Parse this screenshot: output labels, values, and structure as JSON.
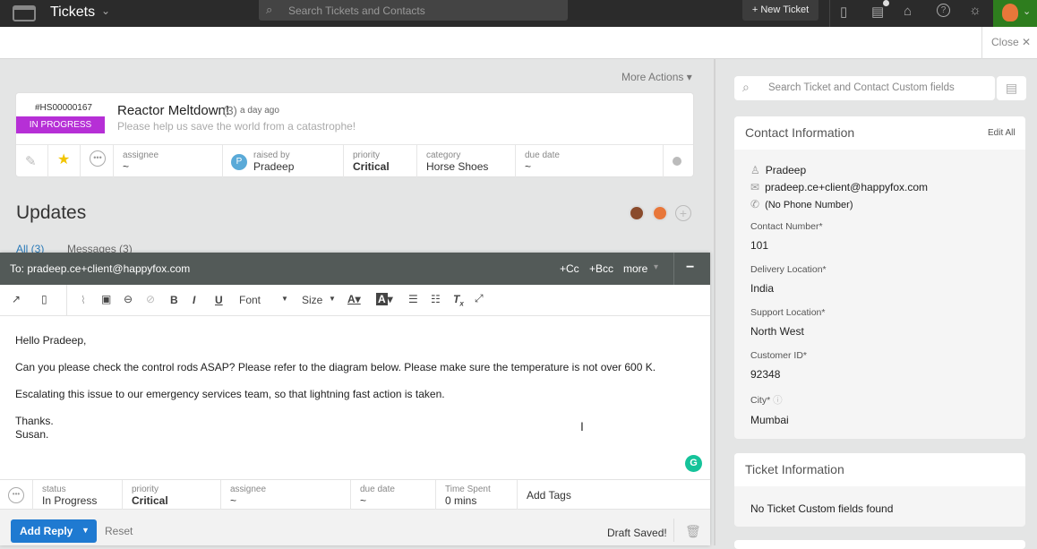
{
  "topbar": {
    "app_title": "Tickets",
    "search_placeholder": "Search Tickets and Contacts",
    "new_ticket": "+ New Ticket"
  },
  "subbar": {
    "close": "Close ✕"
  },
  "more_actions": "More Actions ▾",
  "ticket": {
    "id": "#HS00000167",
    "status": "IN PROGRESS",
    "status_color": "#b62fd6",
    "title": "Reactor Meltdown!",
    "count": "(3)",
    "age": "a day ago",
    "summary": "Please help us save the world from a catastrophe!",
    "meta": {
      "assignee_label": "assignee",
      "assignee": "~",
      "raised_label": "raised by",
      "raised_initial": "P",
      "raised": "Pradeep",
      "priority_label": "priority",
      "priority": "Critical",
      "category_label": "category",
      "category": "Horse Shoes",
      "due_label": "due date",
      "due": "~"
    }
  },
  "updates": {
    "title": "Updates",
    "tab_all": "All (3)",
    "tab_messages": "Messages (3)"
  },
  "composer": {
    "to": "To: pradeep.ce+client@happyfox.com",
    "cc": "+Cc",
    "bcc": "+Bcc",
    "more": "more",
    "minimize": "−",
    "toolbar": {
      "font": "Font",
      "size": "Size",
      "bold": "B",
      "italic": "I",
      "underline": "U"
    },
    "body": [
      "Hello Pradeep,",
      "Can you please check the control rods ASAP? Please refer to the diagram below. Please make sure the temperature is not over 600 K.",
      "Escalating this issue to our emergency services team, so that lightning fast action is taken.",
      "Thanks.",
      "Susan."
    ],
    "fields": {
      "status_label": "status",
      "status": "In Progress",
      "priority_label": "priority",
      "priority": "Critical",
      "assignee_label": "assignee",
      "assignee": "~",
      "due_label": "due date",
      "due": "~",
      "time_label": "Time Spent",
      "time": "0 mins",
      "tags": "Add Tags"
    },
    "add_reply": "Add Reply",
    "reset": "Reset",
    "draft": "Draft Saved!"
  },
  "right": {
    "search_placeholder": "Search Ticket and Contact Custom fields",
    "contact": {
      "title": "Contact Information",
      "edit_all": "Edit All",
      "name": "Pradeep",
      "email": "pradeep.ce+client@happyfox.com",
      "phone": "(No Phone Number)",
      "fields": [
        {
          "label": "Contact Number*",
          "value": "101"
        },
        {
          "label": "Delivery Location*",
          "value": "India"
        },
        {
          "label": "Support Location*",
          "value": "North West"
        },
        {
          "label": "Customer ID*",
          "value": "92348"
        },
        {
          "label": "City*",
          "value": "Mumbai"
        }
      ]
    },
    "ticket_info": {
      "title": "Ticket Information",
      "empty": "No Ticket Custom fields found"
    }
  }
}
